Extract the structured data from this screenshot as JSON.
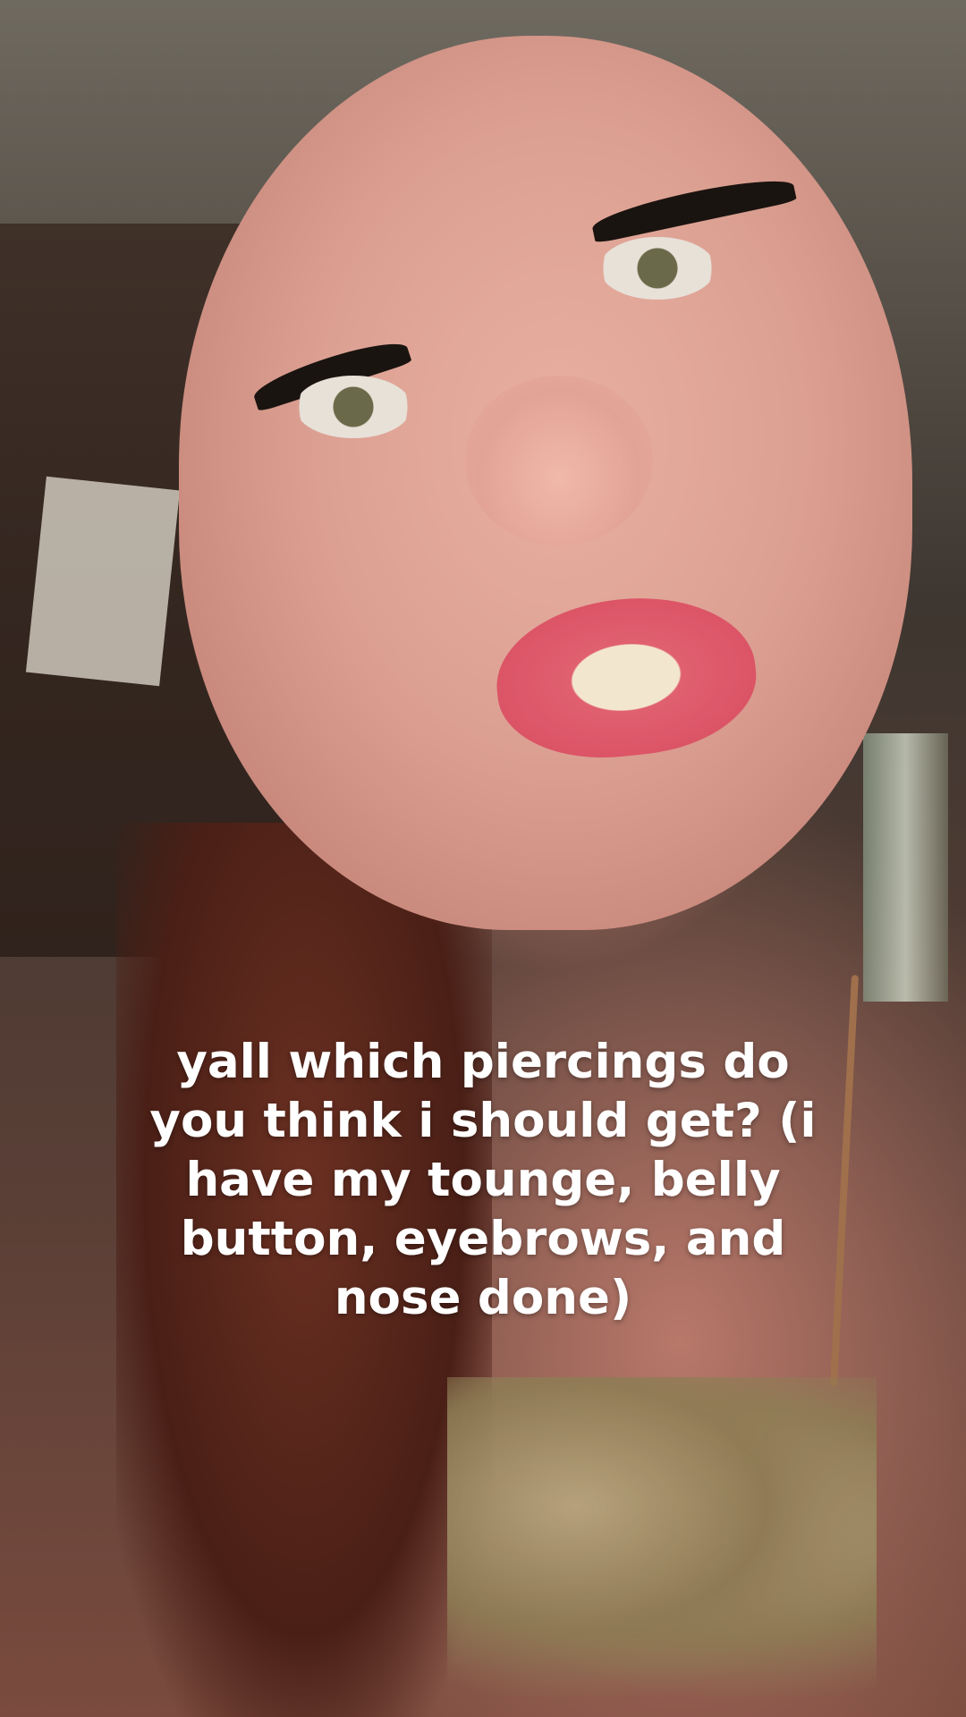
{
  "caption": {
    "text": "yall which piercings do\nyou think i should get? (i\nhave my tounge, belly\nbutton, eyebrows, and\nnose done)"
  },
  "colors": {
    "caption_text": "#ffffff",
    "skin": "#dca092",
    "lips": "#d84c60",
    "hair": "#4a1f16"
  }
}
